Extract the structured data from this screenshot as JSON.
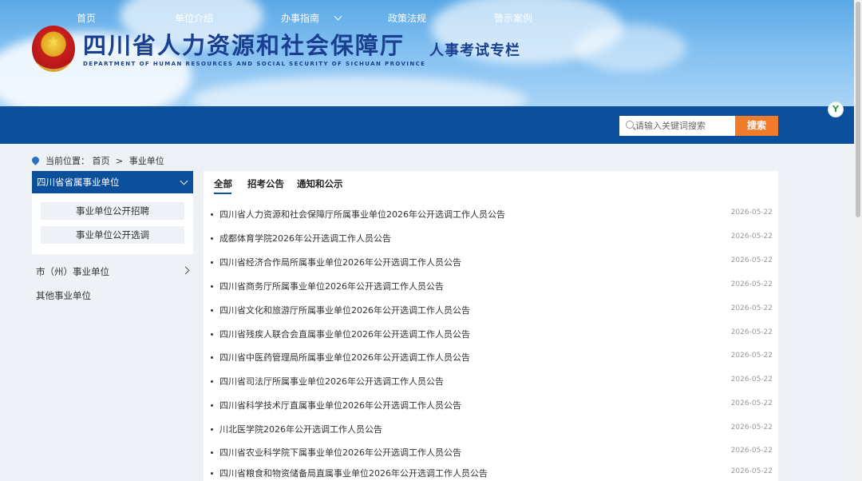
{
  "header": {
    "site_title": "四川省人力资源和社会保障厅",
    "site_subtitle": "DEPARTMENT OF HUMAN RESOURCES AND SOCIAL SECURITY OF SICHUAN PROVINCE",
    "column_title": "人事考试专栏"
  },
  "nav": {
    "items": [
      {
        "label": "首页"
      },
      {
        "label": "单位介绍"
      },
      {
        "label": "办事指南"
      },
      {
        "label": "政策法规"
      },
      {
        "label": "警示案例"
      }
    ],
    "search_placeholder": "请输入关键词搜索",
    "search_button": "搜索"
  },
  "breadcrumb": {
    "prefix": "当前位置：",
    "home": "首页",
    "separator": ">",
    "current": "事业单位"
  },
  "sidebar": {
    "head": "四川省省属事业单位",
    "subs": [
      {
        "label": "事业单位公开招聘"
      },
      {
        "label": "事业单位公开选调"
      }
    ],
    "items": [
      {
        "label": "市（州）事业单位"
      },
      {
        "label": "其他事业单位"
      }
    ]
  },
  "tabs": [
    {
      "label": "全部"
    },
    {
      "label": "招考公告"
    },
    {
      "label": "通知和公示"
    }
  ],
  "list": [
    {
      "title": "四川省人力资源和社会保障厅所属事业单位2026年公开选调工作人员公告",
      "date": "2026-05-22"
    },
    {
      "title": "成都体育学院2026年公开选调工作人员公告",
      "date": "2026-05-22"
    },
    {
      "title": "四川省经济合作局所属事业单位2026年公开选调工作人员公告",
      "date": "2026-05-22"
    },
    {
      "title": "四川省商务厅所属事业单位2026年公开选调工作人员公告",
      "date": "2026-05-22"
    },
    {
      "title": "四川省文化和旅游厅所属事业单位2026年公开选调工作人员公告",
      "date": "2026-05-22"
    },
    {
      "title": "四川省残疾人联合会直属事业单位2026年公开选调工作人员公告",
      "date": "2026-05-22"
    },
    {
      "title": "四川省中医药管理局所属事业单位2026年公开选调工作人员公告",
      "date": "2026-05-22"
    },
    {
      "title": "四川省司法厅所属事业单位2026年公开选调工作人员公告",
      "date": "2026-05-22"
    },
    {
      "title": "四川省科学技术厅直属事业单位2026年公开选调工作人员公告",
      "date": "2026-05-22"
    },
    {
      "title": "川北医学院2026年公开选调工作人员公告",
      "date": "2026-05-22"
    },
    {
      "title": "四川省农业科学院下属事业单位2026年公开选调工作人员公告",
      "date": "2026-05-22"
    },
    {
      "title": "四川省粮食和物资储备局直属事业单位2026年公开选调工作人员公告",
      "date": "2026-05-22"
    }
  ],
  "float_button": "Y"
}
